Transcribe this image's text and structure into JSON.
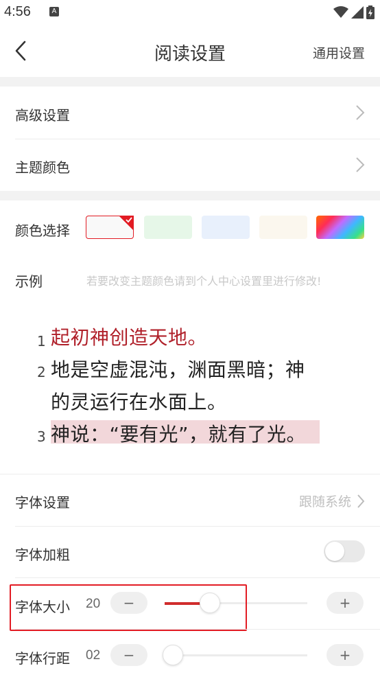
{
  "status_bar": {
    "time": "4:56",
    "notification_icon": "A"
  },
  "header": {
    "title": "阅读设置",
    "right_action": "通用设置",
    "back_icon": "chevron-left-icon"
  },
  "menu": {
    "advanced": "高级设置",
    "theme_color": "主题颜色"
  },
  "color_select": {
    "label": "颜色选择",
    "swatches": [
      {
        "name": "white",
        "color": "#f9f9f9",
        "selected": true
      },
      {
        "name": "green",
        "color": "#e6f7e8",
        "selected": false
      },
      {
        "name": "blue",
        "color": "#e8f0fc",
        "selected": false
      },
      {
        "name": "cream",
        "color": "#fbf7ee",
        "selected": false
      },
      {
        "name": "rainbow",
        "color": "gradient",
        "selected": false
      }
    ],
    "accent": "#e21b23"
  },
  "example": {
    "label": "示例",
    "hint": "若要改变主题颜色请到个人中心设置里进行修改!",
    "verses": [
      {
        "num": "1",
        "lines": [
          "起初神创造天地。"
        ]
      },
      {
        "num": "2",
        "lines": [
          "地是空虚混沌，渊面黑暗；神",
          "的灵运行在水面上。"
        ]
      },
      {
        "num": "3",
        "lines": [
          "神说：“要有光”，就有了光。"
        ]
      }
    ]
  },
  "font_settings": {
    "font_label": "字体设置",
    "font_value": "跟随系统",
    "bold_label": "字体加粗",
    "bold_on": false,
    "size_label": "字体大小",
    "size_value": "20",
    "size_fraction": 0.26,
    "spacing_label": "字体行距",
    "spacing_value": "02",
    "spacing_fraction": 0.0,
    "minus": "−",
    "plus": "+"
  }
}
